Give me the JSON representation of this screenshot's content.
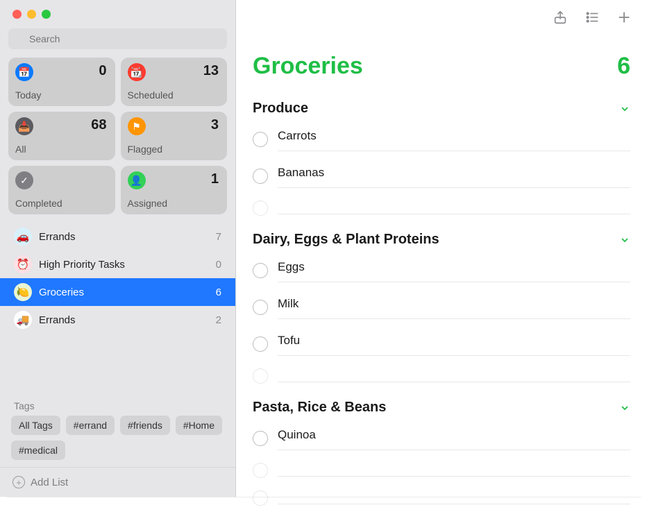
{
  "colors": {
    "accent": "#1fbe46"
  },
  "search": {
    "placeholder": "Search"
  },
  "smartLists": [
    {
      "key": "today",
      "label": "Today",
      "count": 0,
      "iconClass": "ic-today",
      "glyph": "📅"
    },
    {
      "key": "scheduled",
      "label": "Scheduled",
      "count": 13,
      "iconClass": "ic-sched",
      "glyph": "📆"
    },
    {
      "key": "all",
      "label": "All",
      "count": 68,
      "iconClass": "ic-all",
      "glyph": "📥"
    },
    {
      "key": "flagged",
      "label": "Flagged",
      "count": 3,
      "iconClass": "ic-flag",
      "glyph": "⚑"
    },
    {
      "key": "completed",
      "label": "Completed",
      "count": "",
      "iconClass": "ic-comp",
      "glyph": "✓"
    },
    {
      "key": "assigned",
      "label": "Assigned",
      "count": 1,
      "iconClass": "ic-assign",
      "glyph": "👤"
    }
  ],
  "myLists": [
    {
      "name": "Errands",
      "count": 7,
      "dotClass": "dot-errands",
      "emoji": "🚗",
      "selected": false
    },
    {
      "name": "High Priority Tasks",
      "count": 0,
      "dotClass": "dot-hp",
      "emoji": "⏰",
      "selected": false
    },
    {
      "name": "Groceries",
      "count": 6,
      "dotClass": "dot-groc",
      "emoji": "🍋",
      "selected": true
    },
    {
      "name": "Errands",
      "count": 2,
      "dotClass": "dot-errands2",
      "emoji": "🚚",
      "selected": false
    }
  ],
  "tagsHeader": "Tags",
  "tags": [
    "All Tags",
    "#errand",
    "#friends",
    "#Home",
    "#medical"
  ],
  "addList": "Add List",
  "main": {
    "title": "Groceries",
    "count": 6,
    "sections": [
      {
        "title": "Produce",
        "items": [
          "Carrots",
          "Bananas"
        ]
      },
      {
        "title": "Dairy, Eggs & Plant Proteins",
        "items": [
          "Eggs",
          "Milk",
          "Tofu"
        ]
      },
      {
        "title": "Pasta, Rice & Beans",
        "items": [
          "Quinoa"
        ]
      }
    ]
  }
}
